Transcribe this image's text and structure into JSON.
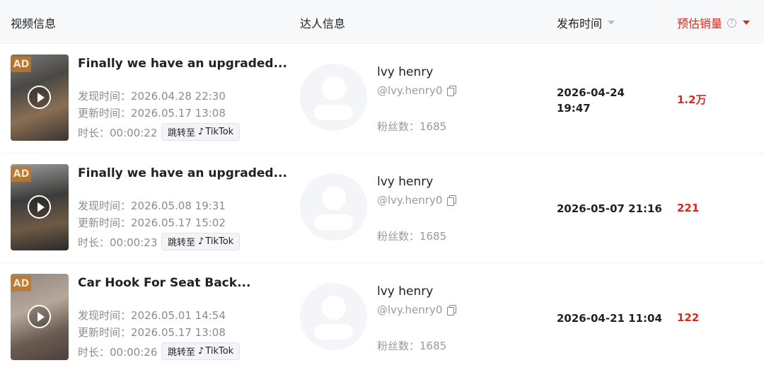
{
  "header": {
    "video_info": "视频信息",
    "creator_info": "达人信息",
    "publish_time": "发布时间",
    "est_sales": "预估销量",
    "help_symbol": "?"
  },
  "accent_color": "#e1251b",
  "rows": [
    {
      "ad_badge": "AD",
      "title": "Finally we have an upgraded...",
      "found_time": "发现时间：2026.04.28 22:30",
      "updated_time": "更新时间：2026.05.17 13:08",
      "duration": "时长：00:00:22",
      "tiktok_prefix": "跳转至",
      "tiktok_label": "TikTok",
      "creator_name": "lvy henry",
      "creator_handle": "@lvy.henry0",
      "fans": "粉丝数：1685",
      "publish_time": "2026-04-24 19:47",
      "sales": "1.2万"
    },
    {
      "ad_badge": "AD",
      "title": "Finally we have an upgraded...",
      "found_time": "发现时间：2026.05.08 19:31",
      "updated_time": "更新时间：2026.05.17 15:02",
      "duration": "时长：00:00:23",
      "tiktok_prefix": "跳转至",
      "tiktok_label": "TikTok",
      "creator_name": "lvy henry",
      "creator_handle": "@lvy.henry0",
      "fans": "粉丝数：1685",
      "publish_time": "2026-05-07 21:16",
      "sales": "221"
    },
    {
      "ad_badge": "AD",
      "title": "Car Hook For Seat Back...",
      "found_time": "发现时间：2026.05.01 14:54",
      "updated_time": "更新时间：2026.05.17 13:08",
      "duration": "时长：00:00:26",
      "tiktok_prefix": "跳转至",
      "tiktok_label": "TikTok",
      "creator_name": "lvy henry",
      "creator_handle": "@lvy.henry0",
      "fans": "粉丝数：1685",
      "publish_time": "2026-04-21 11:04",
      "sales": "122"
    }
  ]
}
